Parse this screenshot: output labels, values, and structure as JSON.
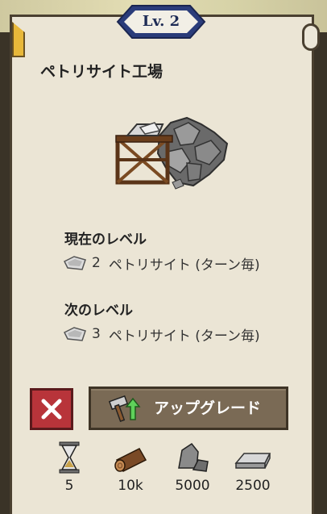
{
  "header": {
    "level": "Lv. 2"
  },
  "building": {
    "name": "ペトリサイト工場"
  },
  "current_level": {
    "label": "現在のレベル",
    "amount": "2",
    "text": "ペトリサイト (ターン毎)"
  },
  "next_level": {
    "label": "次のレベル",
    "amount": "3",
    "text": "ペトリサイト (ターン毎)"
  },
  "actions": {
    "upgrade_label": "アップグレード"
  },
  "costs": [
    {
      "icon": "hourglass-icon",
      "value": "5"
    },
    {
      "icon": "wood-log-icon",
      "value": "10k"
    },
    {
      "icon": "stone-icon",
      "value": "5000"
    },
    {
      "icon": "metal-ingot-icon",
      "value": "2500"
    }
  ],
  "colors": {
    "panel": "#ebe5d5",
    "cancel": "#b8343a",
    "upgrade": "#7a6a55",
    "level_badge": "#1d2b55"
  }
}
